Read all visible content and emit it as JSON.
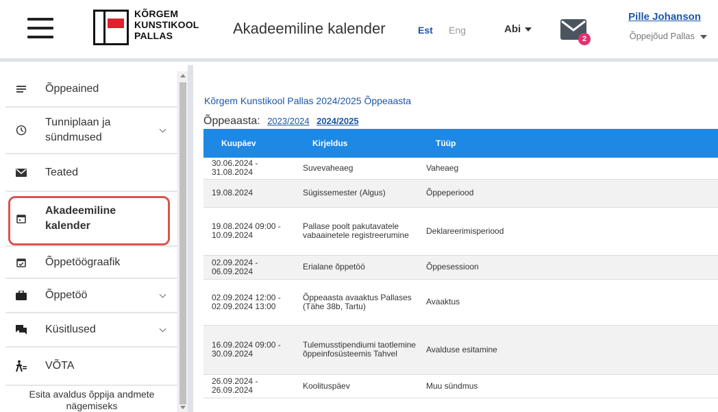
{
  "header": {
    "logo_lines": [
      "KÕRGEM",
      "KUNSTIKOOL",
      "PALLAS"
    ],
    "page_title": "Akadeemiline kalender",
    "lang_est": "Est",
    "lang_eng": "Eng",
    "help_label": "Abi",
    "mail_badge": "2",
    "user_name": "Pille Johanson",
    "user_role": "Õppejõud Pallas"
  },
  "sidebar": {
    "items": [
      {
        "label": "Õppeained",
        "icon": "list-icon"
      },
      {
        "label": "Tunniplaan ja sündmused",
        "icon": "clock-icon"
      },
      {
        "label": "Teated",
        "icon": "envelope-icon"
      },
      {
        "label": "Akadeemiline kalender",
        "icon": "calendar-icon"
      },
      {
        "label": "Õppetöögraafik",
        "icon": "calendar-check-icon"
      },
      {
        "label": "Õppetöö",
        "icon": "briefcase-icon"
      },
      {
        "label": "Küsitlused",
        "icon": "chat-icon"
      },
      {
        "label": "VÕTA",
        "icon": "person-walk-icon"
      }
    ],
    "footer": "Esita avaldus õppija andmete nägemiseks"
  },
  "main": {
    "school_title": "Kõrgem Kunstikool Pallas 2024/2025 Õppeaasta",
    "year_label": "Õppeaasta:",
    "year_options": [
      "2023/2024",
      "2024/2025"
    ],
    "table": {
      "headers": [
        "Kuupäev",
        "Kirjeldus",
        "Tüüp"
      ],
      "rows": [
        {
          "date": "30.06.2024 - 31.08.2024",
          "desc": "Suvevaheaeg",
          "type": "Vaheaeg"
        },
        {
          "date": "19.08.2024",
          "desc": "Sügissemester (Algus)",
          "type": "Õppeperiood"
        },
        {
          "date": "19.08.2024 09:00 - 10.09.2024",
          "desc": "Pallase poolt pakutavatele vabaainetele registreerumine",
          "type": "Deklareerimisperiood"
        },
        {
          "date": "02.09.2024 - 06.09.2024",
          "desc": "Erialane õppetöö",
          "type": "Õppesessioon"
        },
        {
          "date": "02.09.2024 12:00 - 02.09.2024 13:00",
          "desc": "Õppeaasta avaaktus Pallases (Tähe 38b, Tartu)",
          "type": "Avaaktus"
        },
        {
          "date": "16.09.2024 09:00 - 30.09.2024",
          "desc": "Tulemusstipendiumi taotlemine õppeinfosüsteemis Tahvel",
          "type": "Avalduse esitamine"
        },
        {
          "date": "26.09.2024 - 26.09.2024",
          "desc": "Koolituspäev",
          "type": "Muu sündmus"
        }
      ]
    }
  },
  "colors": {
    "accent": "#1e88e5",
    "link": "#1a56a8",
    "highlight_ring": "#d9534f",
    "badge": "#e53070",
    "logo_red": "#e0202e"
  }
}
